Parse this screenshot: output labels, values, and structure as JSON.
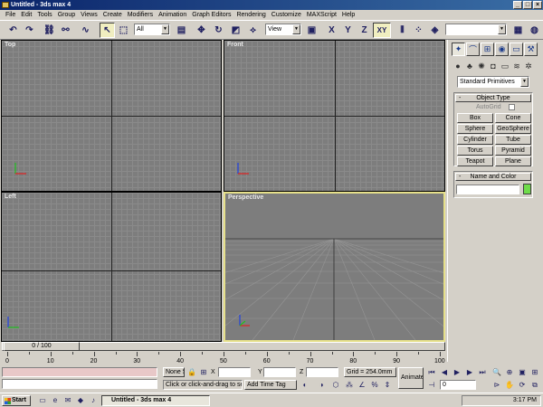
{
  "window": {
    "title": "Untitled - 3ds max 4",
    "controls": [
      "_",
      "□",
      "×"
    ]
  },
  "menu": [
    "File",
    "Edit",
    "Tools",
    "Group",
    "Views",
    "Create",
    "Modifiers",
    "Animation",
    "Graph Editors",
    "Rendering",
    "Customize",
    "MAXScript",
    "Help"
  ],
  "toolbar": {
    "selection_filter": "All",
    "ref_coord": "View",
    "axis_x": "X",
    "axis_y": "Y",
    "axis_z": "Z",
    "axis_xy": "XY",
    "named_selection": ""
  },
  "viewports": {
    "top": "Top",
    "front": "Front",
    "left": "Left",
    "perspective": "Perspective"
  },
  "command_panel": {
    "category": "Standard Primitives",
    "object_type": {
      "header": "Object Type",
      "autogrid": "AutoGrid",
      "buttons": [
        "Box",
        "Cone",
        "Sphere",
        "GeoSphere",
        "Cylinder",
        "Tube",
        "Torus",
        "Pyramid",
        "Teapot",
        "Plane"
      ]
    },
    "name_color": {
      "header": "Name and Color",
      "name_value": "",
      "color": "#6fdc4a"
    }
  },
  "timeline": {
    "slider_label": "0 / 100",
    "ticks": [
      "0",
      "10",
      "20",
      "30",
      "40",
      "50",
      "60",
      "70",
      "80",
      "90",
      "100"
    ],
    "range": [
      0,
      100
    ]
  },
  "status": {
    "selection": "None S",
    "x_label": "X",
    "y_label": "Y",
    "z_label": "Z",
    "x_value": "",
    "y_value": "",
    "z_value": "",
    "grid": "Grid = 254.0mm",
    "prompt": "Click or click-and-drag to selec",
    "add_time_tag": "Add Time Tag",
    "animate": "Animate",
    "frame": "0"
  },
  "taskbar": {
    "start": "Start",
    "task": "Untitled - 3ds max 4",
    "clock": "3:17 PM"
  },
  "colors": {
    "active_viewport_border": "#e6e08a",
    "viewport_bg": "#7d7d7d",
    "title_bar": "#0a246a"
  }
}
